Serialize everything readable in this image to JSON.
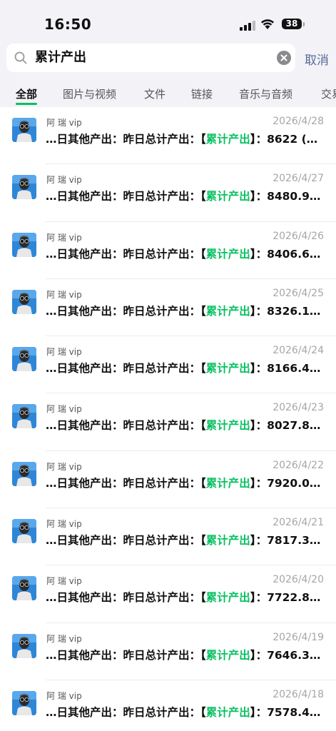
{
  "status_bar": {
    "time": "16:50",
    "battery": "38"
  },
  "search": {
    "query": "累计产出",
    "cancel_label": "取消"
  },
  "tabs": [
    "全部",
    "图片与视频",
    "文件",
    "链接",
    "音乐与音频",
    "交易"
  ],
  "colors": {
    "accent": "#07c160",
    "link": "#576b95"
  },
  "results": [
    {
      "sender": "阿 瑞 vip",
      "date": "2026/4/28",
      "prefix": "…日其他产出：昨日总计产出：",
      "bl": "【",
      "keyword": "累计产出",
      "br": "】",
      "suffix": "：8622 (…"
    },
    {
      "sender": "阿 瑞 vip",
      "date": "2026/4/27",
      "prefix": "…日其他产出：昨日总计产出：",
      "bl": "【",
      "keyword": "累计产出",
      "br": "】",
      "suffix": "：8480.9…"
    },
    {
      "sender": "阿 瑞 vip",
      "date": "2026/4/26",
      "prefix": "…日其他产出：昨日总计产出：",
      "bl": "【",
      "keyword": "累计产出",
      "br": "】",
      "suffix": "：8406.6…"
    },
    {
      "sender": "阿 瑞 vip",
      "date": "2026/4/25",
      "prefix": "…日其他产出：昨日总计产出：",
      "bl": "【",
      "keyword": "累计产出",
      "br": "】",
      "suffix": "：8326.1…"
    },
    {
      "sender": "阿 瑞 vip",
      "date": "2026/4/24",
      "prefix": "…日其他产出：昨日总计产出：",
      "bl": "【",
      "keyword": "累计产出",
      "br": "】",
      "suffix": "：8166.4…"
    },
    {
      "sender": "阿 瑞 vip",
      "date": "2026/4/23",
      "prefix": "…日其他产出：昨日总计产出：",
      "bl": "【",
      "keyword": "累计产出",
      "br": "】",
      "suffix": "：8027.8…"
    },
    {
      "sender": "阿 瑞 vip",
      "date": "2026/4/22",
      "prefix": "…日其他产出：昨日总计产出：",
      "bl": "【",
      "keyword": "累计产出",
      "br": "】",
      "suffix": "：7920.0…"
    },
    {
      "sender": "阿 瑞 vip",
      "date": "2026/4/21",
      "prefix": "…日其他产出：昨日总计产出：",
      "bl": "【",
      "keyword": "累计产出",
      "br": "】",
      "suffix": "：7817.3…"
    },
    {
      "sender": "阿 瑞 vip",
      "date": "2026/4/20",
      "prefix": "…日其他产出：昨日总计产出：",
      "bl": "【",
      "keyword": "累计产出",
      "br": "】",
      "suffix": "：7722.8…"
    },
    {
      "sender": "阿 瑞 vip",
      "date": "2026/4/19",
      "prefix": "…日其他产出：昨日总计产出：",
      "bl": "【",
      "keyword": "累计产出",
      "br": "】",
      "suffix": "：7646.3…"
    },
    {
      "sender": "阿 瑞 vip",
      "date": "2026/4/18",
      "prefix": "…日其他产出：昨日总计产出：",
      "bl": "【",
      "keyword": "累计产出",
      "br": "】",
      "suffix": "：7578.4…"
    }
  ]
}
